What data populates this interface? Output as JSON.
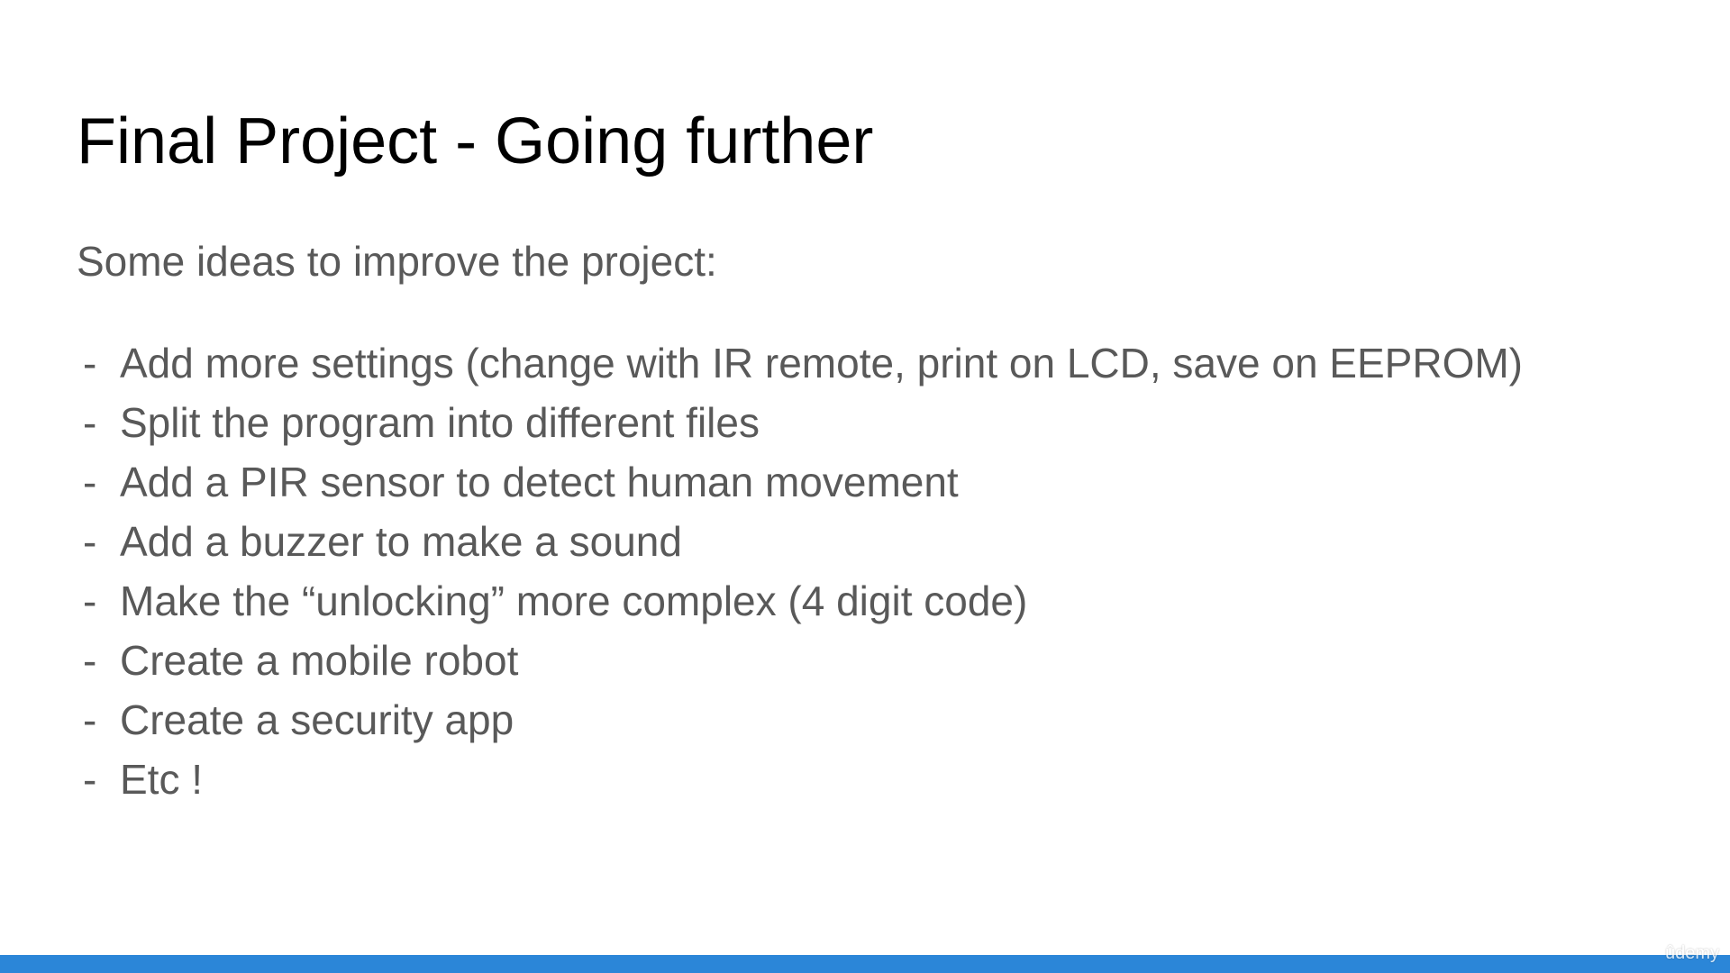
{
  "slide": {
    "title": "Final Project - Going further",
    "subtitle": "Some ideas to improve the project:",
    "bullet_symbol": "-",
    "items": [
      "Add more settings (change with IR remote, print on LCD, save on EEPROM)",
      "Split the program into different files",
      "Add a PIR sensor to detect human movement",
      "Add a buzzer to make a sound",
      "Make the “unlocking” more complex (4 digit code)",
      "Create a mobile robot",
      "Create a security app",
      "Etc !"
    ]
  },
  "watermark": "ûdemy",
  "colors": {
    "title": "#000000",
    "body_text": "#595959",
    "bottom_bar": "#2b86d8",
    "background": "#ffffff"
  }
}
